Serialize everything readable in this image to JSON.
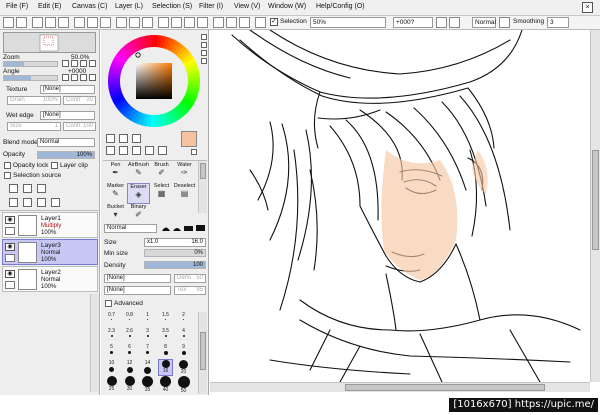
{
  "menu": {
    "items": [
      "File (F)",
      "Edit (E)",
      "Canvas (C)",
      "Layer (L)",
      "Selection (S)",
      "Filter (I)",
      "View (V)",
      "Window (W)",
      "Help/Config (O)"
    ],
    "close_glyph": "×"
  },
  "toolbar": {
    "selection_label": "Selection",
    "selection_checked": "✓",
    "zoom_value": "50%",
    "rotation_value": "+000?",
    "blend_value": "Normal",
    "smoothing_label": "Smoothing",
    "smoothing_value": "3"
  },
  "navigator": {
    "zoom_label": "Zoom",
    "zoom_value": "50.0%",
    "angle_label": "Angle",
    "angle_value": "+0000"
  },
  "brush_settings": {
    "texture_label": "Texture",
    "texture_value": "[None]",
    "grain_label": "Grain",
    "grain_value": "100%",
    "cont_label": "Contr",
    "cont_value": "20",
    "wet_edge_label": "Wet edge",
    "wet_edge_value": "[None]",
    "size_label": "Size",
    "size_value": "1",
    "cont2_value": "100",
    "blend_mode_label": "Blend mode",
    "blend_mode_value": "Normal",
    "opacity_label": "Opacity",
    "opacity_value": "100%",
    "opacity_level": 1.0,
    "opacity_lock_label": "Opacity lock",
    "layer_clip_label": "Layer clip",
    "selection_source_label": "Selection source"
  },
  "layers": [
    {
      "name": "Layer1",
      "mode": "Multiply",
      "opacity": "100%",
      "mode_color": "#b01010",
      "selected": false
    },
    {
      "name": "Layer3",
      "mode": "Normal",
      "opacity": "100%",
      "mode_color": "#111111",
      "selected": true
    },
    {
      "name": "Layer2",
      "mode": "Normal",
      "opacity": "100%",
      "mode_color": "#111111",
      "selected": false
    }
  ],
  "color": {
    "current_color": "#f5c3a0",
    "picked_shade": "#8a5a3c"
  },
  "tools": {
    "items": [
      {
        "label": "Pen",
        "glyph": "✒",
        "selected": false
      },
      {
        "label": "AirBrush",
        "glyph": "✎",
        "selected": false
      },
      {
        "label": "Brush",
        "glyph": "✐",
        "selected": false
      },
      {
        "label": "Water",
        "glyph": "✑",
        "selected": false
      },
      {
        "label": "Marker",
        "glyph": "✎",
        "selected": false
      },
      {
        "label": "Eraser",
        "glyph": "◈",
        "selected": true
      },
      {
        "label": "Select",
        "glyph": "▦",
        "selected": false
      },
      {
        "label": "Deselect",
        "glyph": "▤",
        "selected": false
      },
      {
        "label": "Bucket",
        "glyph": "▾",
        "selected": false
      },
      {
        "label": "Binary",
        "glyph": "✐",
        "selected": false
      }
    ],
    "mode_value": "Normal",
    "size_label": "Size",
    "size_multiplier": "x1.0",
    "size_value": "16.0",
    "min_size_label": "Min size",
    "min_size_value": "0%",
    "density_label": "Density",
    "density_value": "100",
    "density_level": 1.0,
    "shape1_value": "[None]",
    "shape2_value": "[None]",
    "dens_label": "Dens",
    "dens_value": "50",
    "tex_label": "Tex",
    "tex_value": "95",
    "advanced_label": "Advanced"
  },
  "brush_sizes": [
    {
      "label": "0.7",
      "d": 1
    },
    {
      "label": "0.8",
      "d": 1
    },
    {
      "label": "1",
      "d": 1
    },
    {
      "label": "1.5",
      "d": 1
    },
    {
      "label": "2",
      "d": 1
    },
    {
      "label": "2.3",
      "d": 2
    },
    {
      "label": "2.6",
      "d": 2
    },
    {
      "label": "3",
      "d": 2
    },
    {
      "label": "3.5",
      "d": 2
    },
    {
      "label": "4",
      "d": 2
    },
    {
      "label": "5",
      "d": 3
    },
    {
      "label": "6",
      "d": 3
    },
    {
      "label": "7",
      "d": 3
    },
    {
      "label": "8",
      "d": 4
    },
    {
      "label": "9",
      "d": 4
    },
    {
      "label": "10",
      "d": 5
    },
    {
      "label": "12",
      "d": 6
    },
    {
      "label": "14",
      "d": 7
    },
    {
      "label": "16",
      "d": 8
    },
    {
      "label": "20",
      "d": 9
    },
    {
      "label": "25",
      "d": 10
    },
    {
      "label": "30",
      "d": 10
    },
    {
      "label": "35",
      "d": 11
    },
    {
      "label": "40",
      "d": 11
    },
    {
      "label": "50",
      "d": 12
    }
  ],
  "selected_brush_size": "16",
  "watermark": "[1016x670] https://upic.me/"
}
